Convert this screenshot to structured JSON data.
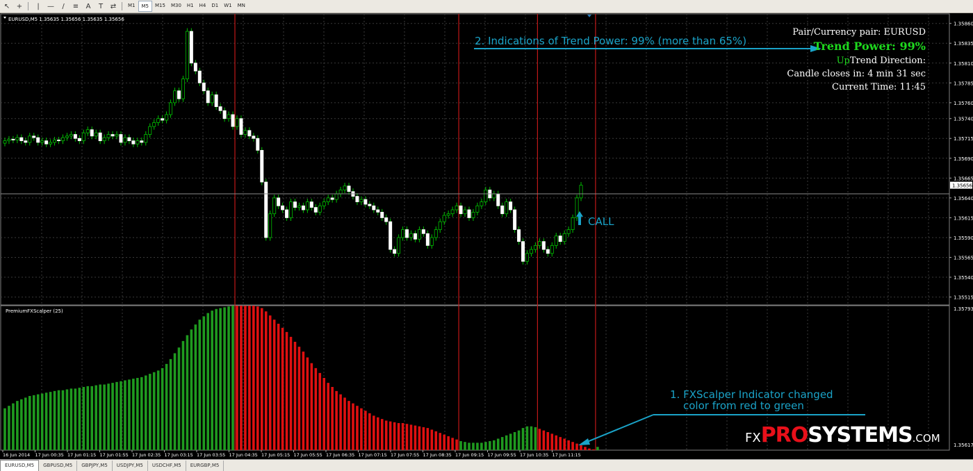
{
  "toolbar": {
    "icons": [
      "cursor-icon",
      "crosshair-icon",
      "vertical-line-icon",
      "horizontal-line-icon",
      "trendline-icon",
      "channel-icon",
      "text-icon",
      "text-label-icon",
      "arrows-icon"
    ],
    "timeframes": [
      "M1",
      "M5",
      "M15",
      "M30",
      "H1",
      "H4",
      "D1",
      "W1",
      "MN"
    ],
    "active_timeframe": "M5"
  },
  "main_chart": {
    "title": "EURUSD,M5  1.35635 1.35656 1.35635 1.35656",
    "price_labels": [
      "1.35860",
      "1.35835",
      "1.35810",
      "1.35785",
      "1.35760",
      "1.35740",
      "1.35715",
      "1.35690",
      "1.35665",
      "1.35640",
      "1.35615",
      "1.35590",
      "1.35565",
      "1.35540",
      "1.35515"
    ],
    "current_price": "1.35656",
    "ylim": [
      1.35505,
      1.35872
    ],
    "candle_color": "#00c000"
  },
  "indicator": {
    "title": "PremiumFXScalper (25)",
    "top_label": "1.35793",
    "bottom_label": "1.35617",
    "colors": {
      "green": "#1f9a1f",
      "red": "#e01010"
    }
  },
  "time_labels": [
    "16 Jun 2014",
    "17 Jun 00:35",
    "17 Jun 01:15",
    "17 Jun 01:55",
    "17 Jun 02:35",
    "17 Jun 03:15",
    "17 Jun 03:55",
    "17 Jun 04:35",
    "17 Jun 05:15",
    "17 Jun 05:55",
    "17 Jun 06:35",
    "17 Jun 07:15",
    "17 Jun 07:55",
    "17 Jun 08:35",
    "17 Jun 09:15",
    "17 Jun 09:55",
    "17 Jun 10:35",
    "17 Jun 11:15"
  ],
  "info_panel": {
    "pair": "Pair/Currency pair: EURUSD",
    "trend_power": "Trend Power: 99%",
    "trend_power_color": "#1ed81e",
    "trend_direction_prefix": "Up",
    "trend_direction": "Trend Direction:",
    "candle_closes": "Candle closes in: 4 min 31 sec",
    "current_time": "Current Time: 11:45"
  },
  "annotations": {
    "trend_note": "2. Indications of Trend Power: 99% (more than 65%)",
    "call_label": "CALL",
    "indicator_note_line1": "1. FXScalper Indicator changed",
    "indicator_note_line2": "color from red to green",
    "accent_color": "#1aa3c8"
  },
  "logo": {
    "prefix": "FX",
    "pro": "PRO",
    "systems": "SYSTEMS",
    "suffix": ".COM",
    "pro_color": "#e8101a"
  },
  "tabs": [
    "EURUSD,M5",
    "GBPUSD,M5",
    "GBPJPY,M5",
    "USDJPY,M5",
    "USDCHF,M5",
    "EURGBP,M5"
  ],
  "active_tab": "EURUSD,M5",
  "chart_data": [
    {
      "type": "candlestick",
      "title": "EURUSD,M5",
      "ylim": [
        1.35505,
        1.35872
      ],
      "close": [
        1.35712,
        1.35714,
        1.35713,
        1.35716,
        1.35712,
        1.3571,
        1.35718,
        1.35716,
        1.3571,
        1.35712,
        1.35708,
        1.3571,
        1.35713,
        1.35712,
        1.35716,
        1.35718,
        1.3572,
        1.35715,
        1.35712,
        1.35722,
        1.35726,
        1.35718,
        1.35722,
        1.35712,
        1.35716,
        1.3572,
        1.35718,
        1.3572,
        1.3571,
        1.35716,
        1.35712,
        1.35708,
        1.35712,
        1.3571,
        1.3572,
        1.3573,
        1.35735,
        1.3574,
        1.35738,
        1.35745,
        1.3576,
        1.35775,
        1.35765,
        1.3579,
        1.3585,
        1.3581,
        1.358,
        1.35785,
        1.35775,
        1.3576,
        1.3577,
        1.35755,
        1.3575,
        1.3574,
        1.35745,
        1.3573,
        1.3574,
        1.3572,
        1.35725,
        1.35718,
        1.35715,
        1.357,
        1.3566,
        1.3559,
        1.3562,
        1.3564,
        1.3563,
        1.35625,
        1.35615,
        1.35635,
        1.35628,
        1.3563,
        1.35625,
        1.35635,
        1.35628,
        1.35622,
        1.3563,
        1.35635,
        1.3564,
        1.35638,
        1.35645,
        1.3565,
        1.35655,
        1.35648,
        1.35642,
        1.35635,
        1.35638,
        1.35632,
        1.3563,
        1.35625,
        1.35622,
        1.35615,
        1.3561,
        1.35575,
        1.3557,
        1.3559,
        1.356,
        1.3559,
        1.35595,
        1.35588,
        1.356,
        1.35595,
        1.3558,
        1.3559,
        1.356,
        1.3561,
        1.35618,
        1.3562,
        1.35625,
        1.3563,
        1.3562,
        1.35625,
        1.35615,
        1.35622,
        1.3563,
        1.35635,
        1.3565,
        1.3564,
        1.35645,
        1.3563,
        1.3562,
        1.35635,
        1.35625,
        1.356,
        1.35585,
        1.3556,
        1.3557,
        1.35575,
        1.3558,
        1.35585,
        1.35575,
        1.3557,
        1.3558,
        1.35592,
        1.35585,
        1.35595,
        1.356,
        1.35615,
        1.3564,
        1.35656
      ],
      "annotation": "CALL"
    },
    {
      "type": "bar",
      "title": "PremiumFXScalper (25)",
      "ylim": [
        1.35617,
        1.35793
      ],
      "values": [
        1.35668,
        1.35671,
        1.35674,
        1.35677,
        1.35679,
        1.35681,
        1.35683,
        1.35684,
        1.35685,
        1.35686,
        1.35687,
        1.35688,
        1.35689,
        1.3569,
        1.3569,
        1.35691,
        1.35692,
        1.35692,
        1.35693,
        1.35694,
        1.35695,
        1.35695,
        1.35696,
        1.35697,
        1.35697,
        1.35698,
        1.35699,
        1.357,
        1.35701,
        1.35702,
        1.35703,
        1.35704,
        1.35705,
        1.35706,
        1.35708,
        1.3571,
        1.35712,
        1.35714,
        1.35717,
        1.35722,
        1.35728,
        1.35735,
        1.35742,
        1.3575,
        1.35757,
        1.35764,
        1.3577,
        1.35776,
        1.3578,
        1.35784,
        1.35787,
        1.35789,
        1.3579,
        1.35791,
        1.35792,
        1.35793,
        1.35793,
        1.35793,
        1.35793,
        1.35793,
        1.35793,
        1.35792,
        1.3579,
        1.35786,
        1.35781,
        1.35776,
        1.35771,
        1.35766,
        1.35761,
        1.35755,
        1.35749,
        1.35743,
        1.35737,
        1.3573,
        1.35723,
        1.35717,
        1.35711,
        1.35705,
        1.35699,
        1.35694,
        1.35689,
        1.35685,
        1.35681,
        1.35677,
        1.35674,
        1.35671,
        1.35668,
        1.35665,
        1.35662,
        1.35659,
        1.35657,
        1.35655,
        1.35653,
        1.35652,
        1.35651,
        1.3565,
        1.3565,
        1.35649,
        1.35648,
        1.35647,
        1.35646,
        1.35645,
        1.35644,
        1.35642,
        1.3564,
        1.35638,
        1.35636,
        1.35634,
        1.35632,
        1.3563,
        1.35628,
        1.35627,
        1.35626,
        1.35626,
        1.35626,
        1.35626,
        1.35627,
        1.35628,
        1.35629,
        1.35631,
        1.35633,
        1.35635,
        1.35637,
        1.35639,
        1.35641,
        1.35644,
        1.35646,
        1.35646,
        1.35645,
        1.35643,
        1.35641,
        1.35639,
        1.35637,
        1.35635,
        1.35633,
        1.35631,
        1.35629,
        1.35627,
        1.35625,
        1.35623,
        1.35621,
        1.35619,
        1.35618,
        1.35621
      ],
      "colors": [
        "green",
        "green",
        "green",
        "green",
        "green",
        "green",
        "green",
        "green",
        "green",
        "green",
        "green",
        "green",
        "green",
        "green",
        "green",
        "green",
        "green",
        "green",
        "green",
        "green",
        "green",
        "green",
        "green",
        "green",
        "green",
        "green",
        "green",
        "green",
        "green",
        "green",
        "green",
        "green",
        "green",
        "green",
        "green",
        "green",
        "green",
        "green",
        "green",
        "green",
        "green",
        "green",
        "green",
        "green",
        "green",
        "green",
        "green",
        "green",
        "green",
        "green",
        "green",
        "green",
        "green",
        "green",
        "green",
        "green",
        "red",
        "red",
        "red",
        "red",
        "red",
        "red",
        "red",
        "red",
        "red",
        "red",
        "red",
        "red",
        "red",
        "red",
        "red",
        "red",
        "red",
        "red",
        "red",
        "red",
        "red",
        "red",
        "red",
        "red",
        "red",
        "red",
        "red",
        "red",
        "red",
        "red",
        "red",
        "red",
        "red",
        "red",
        "red",
        "red",
        "red",
        "red",
        "red",
        "red",
        "red",
        "red",
        "red",
        "red",
        "red",
        "red",
        "red",
        "red",
        "red",
        "red",
        "red",
        "red",
        "red",
        "red",
        "green",
        "green",
        "green",
        "green",
        "green",
        "green",
        "green",
        "green",
        "green",
        "green",
        "green",
        "green",
        "green",
        "green",
        "green",
        "green",
        "green",
        "green",
        "green",
        "red",
        "red",
        "red",
        "red",
        "red",
        "red",
        "red",
        "red",
        "red",
        "red",
        "red",
        "red",
        "red",
        "red",
        "green"
      ]
    }
  ]
}
